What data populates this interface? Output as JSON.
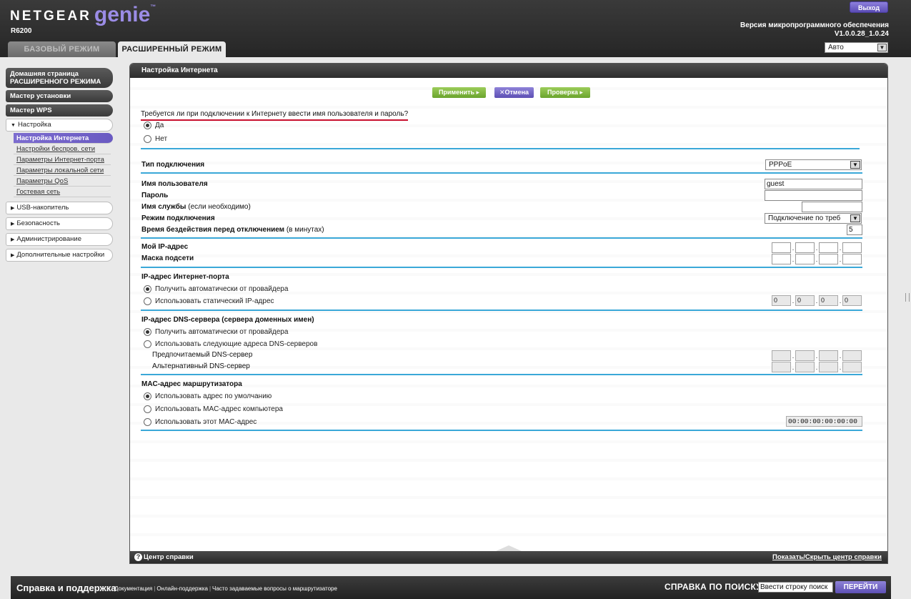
{
  "header": {
    "brand": "NETGEAR",
    "brand_genie": "genie",
    "brand_tm": "™",
    "model": "R6200",
    "logout_label": "Выход",
    "firmware_label": "Версия микропрограммного обеспечения",
    "firmware_version": "V1.0.0.28_1.0.24",
    "language": "Авто",
    "tabs": {
      "basic": "БАЗОВЫЙ РЕЖИМ",
      "advanced": "РАСШИРЕННЫЙ РЕЖИМ"
    }
  },
  "sidebar": {
    "home": "Домашняя страница РАСШИРЕННОГО РЕЖИМА",
    "setup_wizard": "Мастер установки",
    "wps_wizard": "Мастер WPS",
    "setup": "Настройка",
    "setup_items": [
      "Настройка Интернета",
      "Настройки беспров. сети",
      "Параметры Интернет-порта",
      "Параметры локальной сети",
      "Параметры QoS",
      "Гостевая сеть"
    ],
    "usb": "USB-накопитель",
    "security": "Безопасность",
    "admin": "Администрирование",
    "advanced": "Дополнительные настройки"
  },
  "panel": {
    "title": "Настройка Интернета",
    "buttons": {
      "apply": "Применить ▸",
      "cancel": "✕Отмена",
      "test": "Проверка ▸"
    },
    "login_question": "Требуется ли при подключении к Интернету ввести имя пользователя и пароль?",
    "yes": "Да",
    "no": "Нет",
    "conn_type_label": "Тип подключения",
    "conn_type_value": "PPPoE",
    "username_label": "Имя пользователя",
    "username_value": "guest",
    "password_label": "Пароль",
    "service_label": "Имя службы",
    "service_hint": " (если необходимо)",
    "conn_mode_label": "Режим подключения",
    "conn_mode_value": "Подключение по треб",
    "idle_label": "Время бездействия перед отключением",
    "idle_hint": " (в минутах)",
    "idle_value": "5",
    "my_ip_label": "Мой IP-адрес",
    "subnet_label": "Маска подсети",
    "wan_ip_heading": "IP-адрес Интернет-порта",
    "wan_auto": "Получить автоматически от провайдера",
    "wan_static": "Использовать статический IP-адрес",
    "wan_static_ip": [
      "0",
      "0",
      "0",
      "0"
    ],
    "dns_heading": "IP-адрес DNS-сервера (сервера доменных имен)",
    "dns_auto": "Получить автоматически от провайдера",
    "dns_manual": "Использовать следующие адреса DNS-серверов",
    "dns_primary": "Предпочитаемый DNS-сервер",
    "dns_secondary": "Альтернативный DNS-сервер",
    "mac_heading": "MAC-адрес маршрутизатора",
    "mac_default": "Использовать адрес по умолчанию",
    "mac_computer": "Использовать MAC-адрес компьютера",
    "mac_this": "Использовать этот MAC-адрес",
    "mac_value": "00:00:00:00:00:00",
    "help_center": "Центр справки",
    "help_toggle": "Показать/Скрыть центр справки"
  },
  "bottom": {
    "title": "Справка и поддержка",
    "links": [
      "Документация",
      "Онлайн-поддержка",
      "Часто задаваемые вопросы о маршрутизаторе"
    ],
    "search_label": "СПРАВКА ПО ПОИСКУ",
    "search_value": "Ввести строку поиск",
    "go": "ПЕРЕЙТИ"
  }
}
